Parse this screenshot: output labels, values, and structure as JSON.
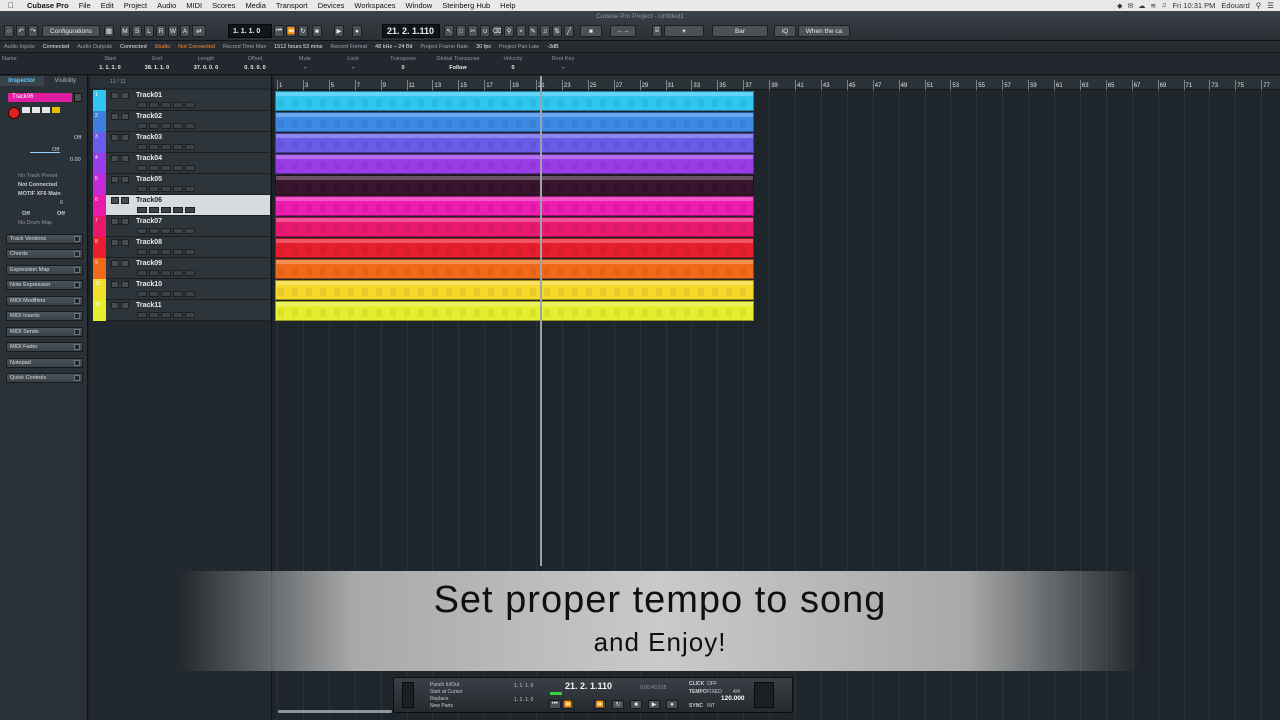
{
  "menubar": {
    "app": "Cubase Pro",
    "items": [
      "File",
      "Edit",
      "Project",
      "Audio",
      "MIDI",
      "Scores",
      "Media",
      "Transport",
      "Devices",
      "Workspaces",
      "Window",
      "Steinberg Hub",
      "Help"
    ],
    "window_title": "Cubase Pro Project - Untitled1",
    "clock": "Fri 10:31 PM",
    "user": "Edouard"
  },
  "toolbar": {
    "configurations": "Configurations",
    "mode_letters": [
      "M",
      "S",
      "L",
      "R",
      "W",
      "A"
    ],
    "position_small": "1. 1. 1. 0",
    "position_display": "21. 2. 1.110",
    "quantize": "Bar",
    "chord_label": "When the ca"
  },
  "status": {
    "audio_inputs_label": "Audio Inputs",
    "audio_inputs_value": "Connected",
    "audio_outputs_label": "Audio Outputs",
    "audio_outputs_value": "Connected",
    "studio_label": "Studio",
    "studio_value": "Not Connected",
    "record_time_label": "Record Time Max",
    "record_time_value": "1512 hours 53 mins",
    "record_format_label": "Record Format",
    "record_format_value": "48 kHz – 24 Bit",
    "frame_rate_label": "Project Frame Rate",
    "frame_rate_value": "30 fps",
    "pan_law_label": "Project Pan Law",
    "pan_law_value": "-3dB"
  },
  "infoline": [
    {
      "label": "Name",
      "value": ""
    },
    {
      "label": "Start",
      "value": "1. 1. 1. 0"
    },
    {
      "label": "End",
      "value": "38. 1. 1. 0"
    },
    {
      "label": "Length",
      "value": "37. 0. 0. 0"
    },
    {
      "label": "Offset",
      "value": "0. 0. 0. 0"
    },
    {
      "label": "Mute",
      "value": "-"
    },
    {
      "label": "Lock",
      "value": "-"
    },
    {
      "label": "Transpose",
      "value": "0"
    },
    {
      "label": "Global Transpose",
      "value": "Follow"
    },
    {
      "label": "Velocity",
      "value": "0"
    },
    {
      "label": "Root Key",
      "value": "-"
    }
  ],
  "inspector": {
    "tabs": [
      "Inspector",
      "Visibility"
    ],
    "track_name": "Track06",
    "off1": "Off",
    "off2": "Off",
    "value": "0.00",
    "preset": "No Track Preset",
    "input": "Not Connected",
    "output": "MOTIF XF6 Main",
    "channel": "6",
    "off3": "Off",
    "off4": "Off",
    "drum_map": "No Drum Map",
    "sections": [
      "Track Versions",
      "Chords",
      "Expression Map",
      "Note Expression",
      "MIDI Modifiers",
      "MIDI Inserts",
      "MIDI Sends",
      "MIDI Fader",
      "Notepad",
      "Quick Controls"
    ]
  },
  "tracklist": {
    "count": "11 / 11",
    "tracks": [
      {
        "name": "Track01",
        "num": "1",
        "color": "#2fc6f0"
      },
      {
        "name": "Track02",
        "num": "2",
        "color": "#3d7fe0"
      },
      {
        "name": "Track03",
        "num": "3",
        "color": "#6a5ce8"
      },
      {
        "name": "Track04",
        "num": "4",
        "color": "#9a3ce8"
      },
      {
        "name": "Track05",
        "num": "5",
        "color": "#c22ad8"
      },
      {
        "name": "Track06",
        "num": "6",
        "color": "#e81ca8"
      },
      {
        "name": "Track07",
        "num": "7",
        "color": "#e8186a"
      },
      {
        "name": "Track08",
        "num": "8",
        "color": "#e81e2e"
      },
      {
        "name": "Track09",
        "num": "9",
        "color": "#f06a1a"
      },
      {
        "name": "Track10",
        "num": "10",
        "color": "#f0e02a"
      },
      {
        "name": "Track11",
        "num": "11",
        "color": "#e6ef2e"
      }
    ]
  },
  "ruler": {
    "bars": [
      "1",
      "3",
      "5",
      "7",
      "9",
      "11",
      "13",
      "15",
      "17",
      "19",
      "21",
      "23",
      "25",
      "27",
      "29",
      "31",
      "33",
      "35",
      "37",
      "39",
      "41",
      "43",
      "45",
      "47",
      "49",
      "51",
      "53",
      "55",
      "57",
      "59",
      "61",
      "63",
      "65",
      "67",
      "69",
      "71",
      "73",
      "75",
      "77"
    ]
  },
  "parts": [
    {
      "color": "#2fc6f0"
    },
    {
      "color": "#3d8ae6"
    },
    {
      "color": "#6a5ce8"
    },
    {
      "color": "#9a3ce8"
    },
    {
      "color": "#3a1530"
    },
    {
      "color": "#ee1cb0"
    },
    {
      "color": "#ea1a72"
    },
    {
      "color": "#e81e2e"
    },
    {
      "color": "#f06a1a"
    },
    {
      "color": "#f5d82a"
    },
    {
      "color": "#e6ef2e"
    }
  ],
  "caption": {
    "line1": "Set proper tempo to song",
    "line2": "and Enjoy!"
  },
  "transport": {
    "punch": "Punch In/Out",
    "start_at_cursor": "Start at Cursor",
    "replace": "Replace",
    "new_parts": "New Parts",
    "left_locator": "1. 1. 1. 0",
    "right_locator": "1. 1. 1. 0",
    "position": "21. 2. 1.110",
    "time": "0:00:40.515",
    "click_label": "CLICK",
    "click_value": "OFF",
    "tempo_label": "TEMPO",
    "tempo_mode": "FIXED",
    "signature": "4/4",
    "tempo_value": "120.000",
    "sync_label": "SYNC",
    "sync_value": "INT"
  }
}
